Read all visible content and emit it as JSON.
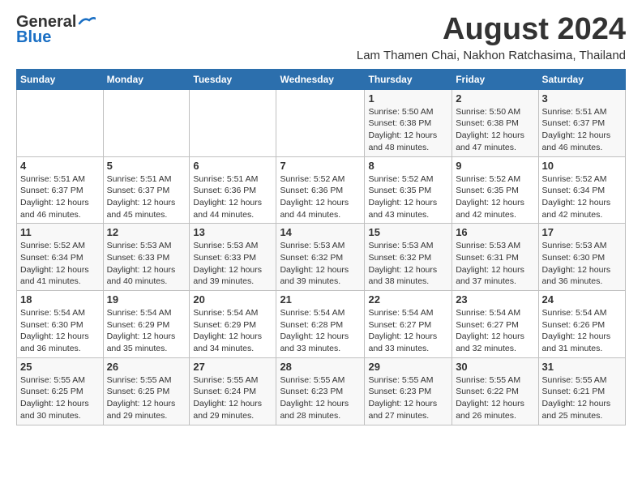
{
  "header": {
    "logo_general": "General",
    "logo_blue": "Blue",
    "main_title": "August 2024",
    "sub_title": "Lam Thamen Chai, Nakhon Ratchasima, Thailand"
  },
  "calendar": {
    "days_of_week": [
      "Sunday",
      "Monday",
      "Tuesday",
      "Wednesday",
      "Thursday",
      "Friday",
      "Saturday"
    ],
    "weeks": [
      [
        {
          "day": "",
          "info": ""
        },
        {
          "day": "",
          "info": ""
        },
        {
          "day": "",
          "info": ""
        },
        {
          "day": "",
          "info": ""
        },
        {
          "day": "1",
          "info": "Sunrise: 5:50 AM\nSunset: 6:38 PM\nDaylight: 12 hours\nand 48 minutes."
        },
        {
          "day": "2",
          "info": "Sunrise: 5:50 AM\nSunset: 6:38 PM\nDaylight: 12 hours\nand 47 minutes."
        },
        {
          "day": "3",
          "info": "Sunrise: 5:51 AM\nSunset: 6:37 PM\nDaylight: 12 hours\nand 46 minutes."
        }
      ],
      [
        {
          "day": "4",
          "info": "Sunrise: 5:51 AM\nSunset: 6:37 PM\nDaylight: 12 hours\nand 46 minutes."
        },
        {
          "day": "5",
          "info": "Sunrise: 5:51 AM\nSunset: 6:37 PM\nDaylight: 12 hours\nand 45 minutes."
        },
        {
          "day": "6",
          "info": "Sunrise: 5:51 AM\nSunset: 6:36 PM\nDaylight: 12 hours\nand 44 minutes."
        },
        {
          "day": "7",
          "info": "Sunrise: 5:52 AM\nSunset: 6:36 PM\nDaylight: 12 hours\nand 44 minutes."
        },
        {
          "day": "8",
          "info": "Sunrise: 5:52 AM\nSunset: 6:35 PM\nDaylight: 12 hours\nand 43 minutes."
        },
        {
          "day": "9",
          "info": "Sunrise: 5:52 AM\nSunset: 6:35 PM\nDaylight: 12 hours\nand 42 minutes."
        },
        {
          "day": "10",
          "info": "Sunrise: 5:52 AM\nSunset: 6:34 PM\nDaylight: 12 hours\nand 42 minutes."
        }
      ],
      [
        {
          "day": "11",
          "info": "Sunrise: 5:52 AM\nSunset: 6:34 PM\nDaylight: 12 hours\nand 41 minutes."
        },
        {
          "day": "12",
          "info": "Sunrise: 5:53 AM\nSunset: 6:33 PM\nDaylight: 12 hours\nand 40 minutes."
        },
        {
          "day": "13",
          "info": "Sunrise: 5:53 AM\nSunset: 6:33 PM\nDaylight: 12 hours\nand 39 minutes."
        },
        {
          "day": "14",
          "info": "Sunrise: 5:53 AM\nSunset: 6:32 PM\nDaylight: 12 hours\nand 39 minutes."
        },
        {
          "day": "15",
          "info": "Sunrise: 5:53 AM\nSunset: 6:32 PM\nDaylight: 12 hours\nand 38 minutes."
        },
        {
          "day": "16",
          "info": "Sunrise: 5:53 AM\nSunset: 6:31 PM\nDaylight: 12 hours\nand 37 minutes."
        },
        {
          "day": "17",
          "info": "Sunrise: 5:53 AM\nSunset: 6:30 PM\nDaylight: 12 hours\nand 36 minutes."
        }
      ],
      [
        {
          "day": "18",
          "info": "Sunrise: 5:54 AM\nSunset: 6:30 PM\nDaylight: 12 hours\nand 36 minutes."
        },
        {
          "day": "19",
          "info": "Sunrise: 5:54 AM\nSunset: 6:29 PM\nDaylight: 12 hours\nand 35 minutes."
        },
        {
          "day": "20",
          "info": "Sunrise: 5:54 AM\nSunset: 6:29 PM\nDaylight: 12 hours\nand 34 minutes."
        },
        {
          "day": "21",
          "info": "Sunrise: 5:54 AM\nSunset: 6:28 PM\nDaylight: 12 hours\nand 33 minutes."
        },
        {
          "day": "22",
          "info": "Sunrise: 5:54 AM\nSunset: 6:27 PM\nDaylight: 12 hours\nand 33 minutes."
        },
        {
          "day": "23",
          "info": "Sunrise: 5:54 AM\nSunset: 6:27 PM\nDaylight: 12 hours\nand 32 minutes."
        },
        {
          "day": "24",
          "info": "Sunrise: 5:54 AM\nSunset: 6:26 PM\nDaylight: 12 hours\nand 31 minutes."
        }
      ],
      [
        {
          "day": "25",
          "info": "Sunrise: 5:55 AM\nSunset: 6:25 PM\nDaylight: 12 hours\nand 30 minutes."
        },
        {
          "day": "26",
          "info": "Sunrise: 5:55 AM\nSunset: 6:25 PM\nDaylight: 12 hours\nand 29 minutes."
        },
        {
          "day": "27",
          "info": "Sunrise: 5:55 AM\nSunset: 6:24 PM\nDaylight: 12 hours\nand 29 minutes."
        },
        {
          "day": "28",
          "info": "Sunrise: 5:55 AM\nSunset: 6:23 PM\nDaylight: 12 hours\nand 28 minutes."
        },
        {
          "day": "29",
          "info": "Sunrise: 5:55 AM\nSunset: 6:23 PM\nDaylight: 12 hours\nand 27 minutes."
        },
        {
          "day": "30",
          "info": "Sunrise: 5:55 AM\nSunset: 6:22 PM\nDaylight: 12 hours\nand 26 minutes."
        },
        {
          "day": "31",
          "info": "Sunrise: 5:55 AM\nSunset: 6:21 PM\nDaylight: 12 hours\nand 25 minutes."
        }
      ]
    ]
  }
}
